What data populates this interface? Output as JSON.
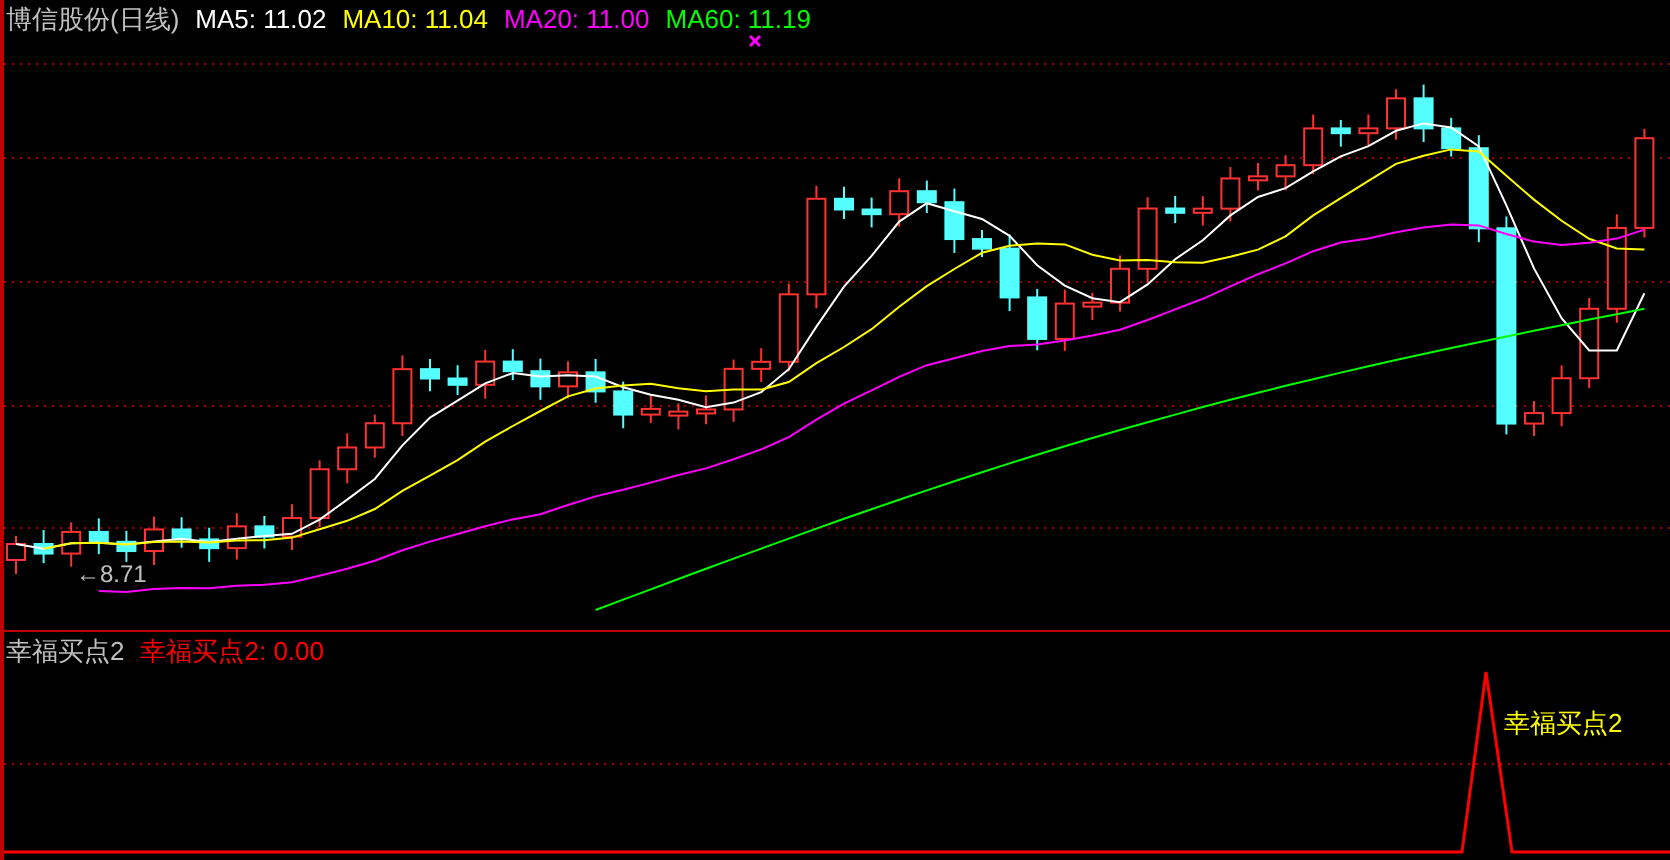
{
  "price_pane": {
    "title": "博信股份(日线)",
    "ma_legend": [
      {
        "label": "MA5: 11.02",
        "color": "#ffffff"
      },
      {
        "label": "MA10: 11.04",
        "color": "#ffff00"
      },
      {
        "label": "MA20: 11.00",
        "color": "#ff00ff"
      },
      {
        "label": "MA60: 11.19",
        "color": "#00ff00"
      }
    ],
    "low_marker": "←8.71"
  },
  "indicator_pane": {
    "title": "幸福买点2",
    "legend": "幸福买点2: 0.00",
    "signal_label": "幸福买点2"
  }
}
